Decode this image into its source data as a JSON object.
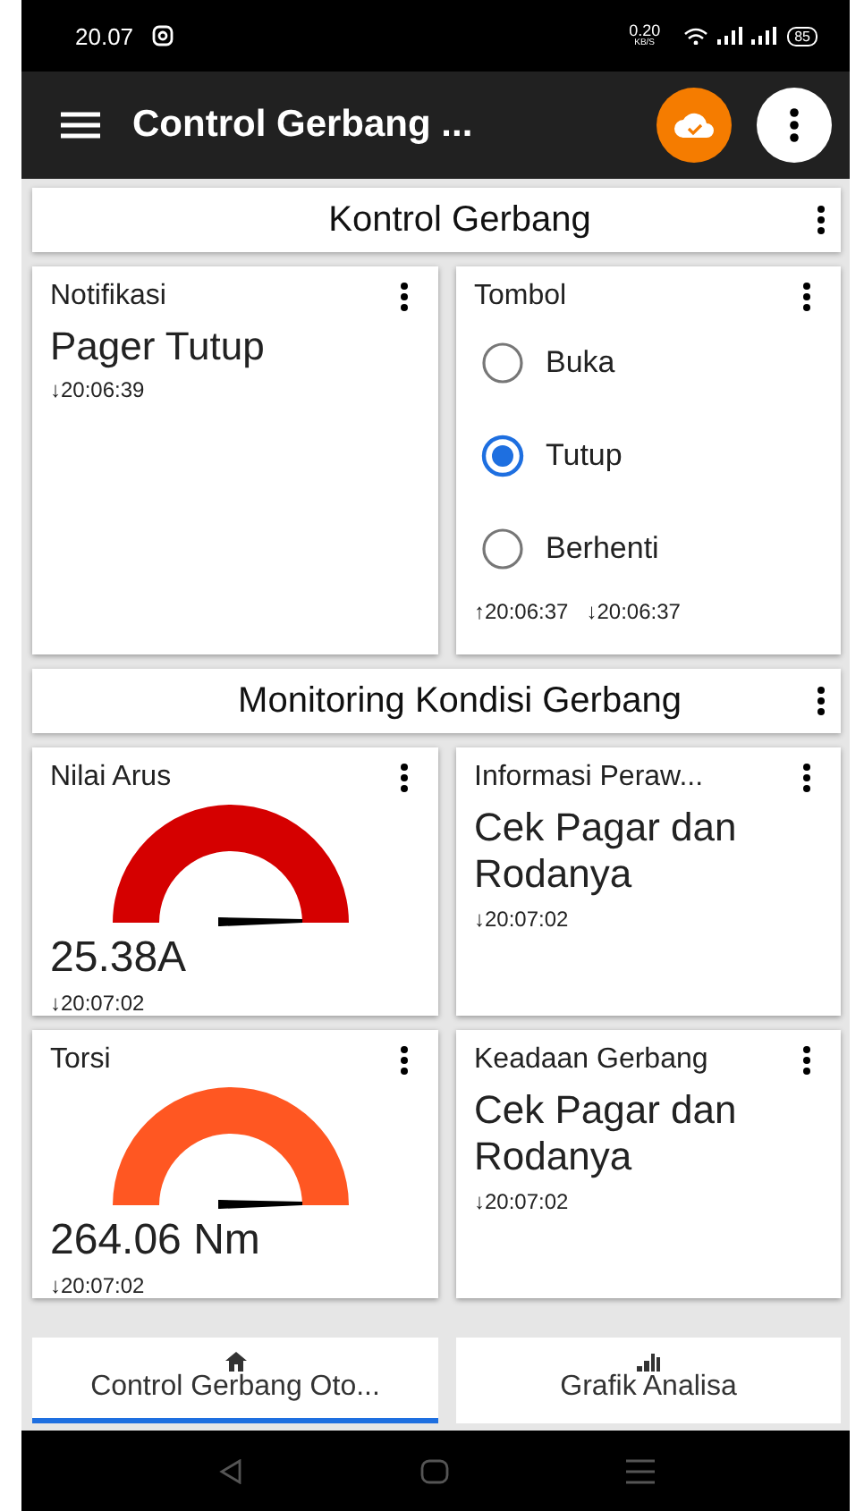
{
  "status_bar": {
    "time": "20.07",
    "speed_value": "0.20",
    "speed_unit": "KB/S",
    "battery": "85"
  },
  "app_bar": {
    "title": "Control Gerbang ..."
  },
  "sections": [
    {
      "title": "Kontrol Gerbang",
      "cards": [
        {
          "kind": "text",
          "title": "Notifikasi",
          "value": "Pager Tutup",
          "times": [
            "↓20:06:39"
          ]
        },
        {
          "kind": "radio",
          "title": "Tombol",
          "options": [
            {
              "label": "Buka",
              "selected": false
            },
            {
              "label": "Tutup",
              "selected": true
            },
            {
              "label": "Berhenti",
              "selected": false
            }
          ],
          "times": [
            "↑20:06:37",
            "↓20:06:37"
          ]
        }
      ]
    },
    {
      "title": "Monitoring Kondisi Gerbang",
      "cards": [
        {
          "kind": "gauge",
          "title": "Nilai Arus",
          "color": "#d50000",
          "value": "25.38A",
          "times": [
            "↓20:07:02"
          ]
        },
        {
          "kind": "text",
          "title": "Informasi Peraw...",
          "value": "Cek Pagar dan Rodanya",
          "times": [
            "↓20:07:02"
          ]
        },
        {
          "kind": "gauge",
          "title": "Torsi",
          "color": "#ff5722",
          "value": "264.06 Nm",
          "times": [
            "↓20:07:02"
          ]
        },
        {
          "kind": "text",
          "title": "Keadaan Gerbang",
          "value": "Cek Pagar dan Rodanya",
          "times": [
            "↓20:07:02"
          ]
        }
      ]
    }
  ],
  "tabs": [
    {
      "label": "Control Gerbang Oto...",
      "kind": "home",
      "selected": true
    },
    {
      "label": "Grafik Analisa",
      "kind": "chart",
      "selected": false
    }
  ]
}
